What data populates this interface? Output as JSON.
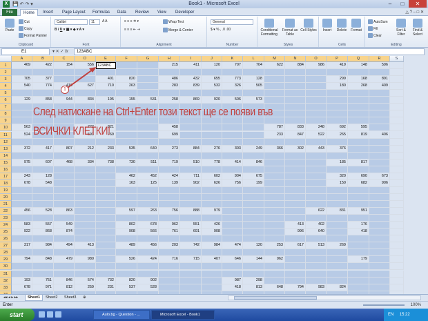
{
  "window": {
    "title": "Book1 - Microsoft Excel"
  },
  "tabs": [
    "File",
    "Home",
    "Insert",
    "Page Layout",
    "Formulas",
    "Data",
    "Review",
    "View",
    "Developer"
  ],
  "ribbon": {
    "clipboard": {
      "paste": "Paste",
      "cut": "Cut",
      "copy": "Copy",
      "format_painter": "Format Painter",
      "title": "Clipboard"
    },
    "font": {
      "name": "Calibri",
      "size": "11",
      "title": "Font"
    },
    "alignment": {
      "wrap": "Wrap Text",
      "merge": "Merge & Center",
      "title": "Alignment"
    },
    "number": {
      "format": "General",
      "title": "Number"
    },
    "styles": {
      "cond": "Conditional Formatting",
      "table": "Format as Table",
      "cell": "Cell Styles",
      "title": "Styles"
    },
    "cells": {
      "insert": "Insert",
      "delete": "Delete",
      "format": "Format",
      "title": "Cells"
    },
    "editing": {
      "autosum": "AutoSum",
      "fill": "Fill",
      "clear": "Clear",
      "sort": "Sort & Filter",
      "find": "Find & Select",
      "title": "Editing"
    }
  },
  "formula_bar": {
    "name_box": "E1",
    "fx": "fx",
    "value": "123ABC"
  },
  "columns": [
    "A",
    "B",
    "C",
    "D",
    "E",
    "F",
    "G",
    "H",
    "I",
    "J",
    "K",
    "L",
    "M",
    "N",
    "O",
    "P",
    "Q",
    "R",
    "S"
  ],
  "grid_rows": [
    {
      "n": "1",
      "c": [
        "469",
        "422",
        "154",
        "556",
        "123ABC",
        "#",
        "",
        "215",
        "411",
        "120",
        "707",
        "704",
        "622",
        "884",
        "986",
        "419",
        "148",
        "596",
        ""
      ]
    },
    {
      "n": "2",
      "c": [
        "",
        "",
        "",
        "",
        "",
        "",
        "",
        "",
        "",
        "",
        "",
        "",
        "",
        "",
        "",
        "",
        "",
        "",
        ""
      ]
    },
    {
      "n": "3",
      "c": [
        "705",
        "377",
        "",
        "",
        "401",
        "820",
        "",
        "486",
        "432",
        "655",
        "773",
        "128",
        "",
        "",
        "",
        "299",
        "168",
        "891",
        ""
      ]
    },
    {
      "n": "4",
      "c": [
        "540",
        "774",
        "410",
        "627",
        "710",
        "263",
        "",
        "283",
        "839",
        "532",
        "326",
        "505",
        "",
        "",
        "",
        "180",
        "268",
        "409",
        ""
      ]
    },
    {
      "n": "5",
      "c": [
        "",
        "",
        "",
        "",
        "",
        "",
        "",
        "",
        "",
        "",
        "",
        "",
        "",
        "",
        "",
        "",
        "",
        "",
        ""
      ]
    },
    {
      "n": "6",
      "c": [
        "129",
        "858",
        "944",
        "834",
        "195",
        "155",
        "531",
        "258",
        "869",
        "920",
        "506",
        "573",
        "",
        "",
        "",
        "",
        "",
        "",
        ""
      ]
    },
    {
      "n": "7",
      "c": [
        "",
        "",
        "",
        "",
        "",
        "",
        "",
        "",
        "",
        "",
        "",
        "",
        "",
        "",
        "",
        "",
        "",
        "",
        ""
      ]
    },
    {
      "n": "8",
      "c": [
        "",
        "",
        "",
        "",
        "",
        "",
        "",
        "",
        "",
        "",
        "",
        "",
        "",
        "",
        "",
        "",
        "",
        "",
        ""
      ]
    },
    {
      "n": "9",
      "c": [
        "",
        "",
        "",
        "",
        "",
        "",
        "",
        "",
        "",
        "",
        "",
        "",
        "",
        "",
        "",
        "",
        "",
        "",
        ""
      ]
    },
    {
      "n": "10",
      "c": [
        "563",
        "",
        "",
        "772",
        "821",
        "",
        "",
        "458",
        "",
        "",
        "",
        "",
        "787",
        "833",
        "248",
        "692",
        "595",
        ""
      ]
    },
    {
      "n": "11",
      "c": [
        "524",
        "",
        "",
        "593",
        "769",
        "",
        "",
        "699",
        "",
        "",
        "",
        "",
        "233",
        "847",
        "522",
        "265",
        "819",
        "406",
        ""
      ]
    },
    {
      "n": "12",
      "c": [
        "",
        "",
        "",
        "",
        "",
        "",
        "",
        "",
        "",
        "",
        "",
        "",
        "",
        "",
        "",
        "",
        "",
        "",
        ""
      ]
    },
    {
      "n": "13",
      "c": [
        "372",
        "417",
        "807",
        "212",
        "233",
        "535",
        "640",
        "273",
        "884",
        "276",
        "303",
        "249",
        "366",
        "302",
        "443",
        "376",
        ""
      ]
    },
    {
      "n": "14",
      "c": [
        "",
        "",
        "",
        "",
        "",
        "",
        "",
        "",
        "",
        "",
        "",
        "",
        "",
        "",
        "",
        "",
        "",
        "",
        ""
      ]
    },
    {
      "n": "15",
      "c": [
        "975",
        "607",
        "468",
        "334",
        "738",
        "730",
        "511",
        "719",
        "510",
        "778",
        "414",
        "846",
        "",
        "",
        "",
        "185",
        "817",
        ""
      ]
    },
    {
      "n": "16",
      "c": [
        "",
        "",
        "",
        "",
        "",
        "",
        "",
        "",
        "",
        "",
        "",
        "",
        "",
        "",
        "",
        "",
        "",
        "",
        ""
      ]
    },
    {
      "n": "17",
      "c": [
        "243",
        "128",
        "",
        "",
        "",
        "462",
        "452",
        "424",
        "711",
        "602",
        "904",
        "675",
        "",
        "",
        "",
        "320",
        "690",
        "673"
      ]
    },
    {
      "n": "18",
      "c": [
        "678",
        "548",
        "",
        "",
        "",
        "163",
        "125",
        "139",
        "902",
        "626",
        "756",
        "199",
        "",
        "",
        "",
        "150",
        "682",
        "906"
      ]
    },
    {
      "n": "19",
      "c": [
        "",
        "",
        "",
        "",
        "",
        "",
        "",
        "",
        "",
        "",
        "",
        "",
        "",
        "",
        "",
        "",
        "",
        "",
        ""
      ]
    },
    {
      "n": "20",
      "c": [
        "",
        "",
        "",
        "",
        "",
        "",
        "",
        "",
        "",
        "",
        "",
        "",
        "",
        "",
        "",
        "",
        "",
        "",
        ""
      ]
    },
    {
      "n": "21",
      "c": [
        "",
        "",
        "",
        "",
        "",
        "",
        "",
        "",
        "",
        "",
        "",
        "",
        "",
        "",
        "",
        "",
        "",
        "",
        ""
      ]
    },
    {
      "n": "22",
      "c": [
        "456",
        "528",
        "863",
        "",
        "",
        "597",
        "263",
        "756",
        "888",
        "979",
        "",
        "",
        "",
        "",
        "622",
        "831",
        "951"
      ]
    },
    {
      "n": "23",
      "c": [
        "",
        "",
        "",
        "",
        "",
        "",
        "",
        "",
        "",
        "",
        "",
        "",
        "",
        "",
        "",
        "",
        "",
        "",
        ""
      ]
    },
    {
      "n": "24",
      "c": [
        "583",
        "557",
        "549",
        "",
        "",
        "802",
        "678",
        "962",
        "551",
        "426",
        "",
        "",
        "",
        "413",
        "402",
        "",
        "176"
      ]
    },
    {
      "n": "25",
      "c": [
        "922",
        "868",
        "874",
        "",
        "",
        "908",
        "566",
        "761",
        "691",
        "908",
        "",
        "",
        "",
        "996",
        "640",
        "",
        "418"
      ]
    },
    {
      "n": "26",
      "c": [
        "",
        "",
        "",
        "",
        "",
        "",
        "",
        "",
        "",
        "",
        "",
        "",
        "",
        "",
        "",
        "",
        "",
        "",
        ""
      ]
    },
    {
      "n": "27",
      "c": [
        "317",
        "984",
        "494",
        "413",
        "",
        "489",
        "456",
        "203",
        "742",
        "984",
        "474",
        "120",
        "253",
        "617",
        "513",
        "269",
        ""
      ]
    },
    {
      "n": "28",
      "c": [
        "",
        "",
        "",
        "",
        "",
        "",
        "",
        "",
        "",
        "",
        "",
        "",
        "",
        "",
        "",
        "",
        "",
        "",
        ""
      ]
    },
    {
      "n": "29",
      "c": [
        "794",
        "848",
        "479",
        "980",
        "",
        "526",
        "424",
        "716",
        "715",
        "407",
        "646",
        "144",
        "962",
        "",
        "",
        "",
        "179",
        "",
        ""
      ]
    },
    {
      "n": "30",
      "c": [
        "",
        "",
        "",
        "",
        "",
        "",
        "",
        "",
        "",
        "",
        "",
        "",
        "",
        "",
        "",
        "",
        "",
        "",
        ""
      ]
    },
    {
      "n": "31",
      "c": [
        "",
        "",
        "",
        "",
        "",
        "",
        "",
        "",
        "",
        "",
        "",
        "",
        "",
        "",
        "",
        "",
        "",
        "",
        ""
      ]
    },
    {
      "n": "32",
      "c": [
        "193",
        "751",
        "846",
        "574",
        "732",
        "820",
        "902",
        "",
        "",
        "",
        "987",
        "298",
        "",
        "",
        "",
        "",
        "",
        "",
        ""
      ]
    },
    {
      "n": "33",
      "c": [
        "678",
        "971",
        "812",
        "259",
        "231",
        "537",
        "528",
        "",
        "",
        "",
        "418",
        "813",
        "648",
        "794",
        "983",
        "824",
        "",
        ""
      ]
    },
    {
      "n": "34",
      "c": [
        "",
        "",
        "",
        "",
        "",
        "",
        "",
        "",
        "",
        "",
        "",
        "",
        "",
        "",
        "",
        "",
        "",
        "",
        ""
      ]
    }
  ],
  "overlay": {
    "line1": "След натискане на Ctrl+Enter този текст ще се появи във",
    "line2": "ВСИЧКИ КЛЕТКИ!",
    "marker": "1"
  },
  "sheets": [
    "Sheet1",
    "Sheet2",
    "Sheet3"
  ],
  "status": {
    "mode": "Enter",
    "zoom": "100%"
  },
  "taskbar": {
    "start": "start",
    "items": [
      "Aulo.bg - Question - ...",
      "Microsoft Excel - Book1"
    ],
    "tray_lang": "EN",
    "clock": "15:22"
  }
}
